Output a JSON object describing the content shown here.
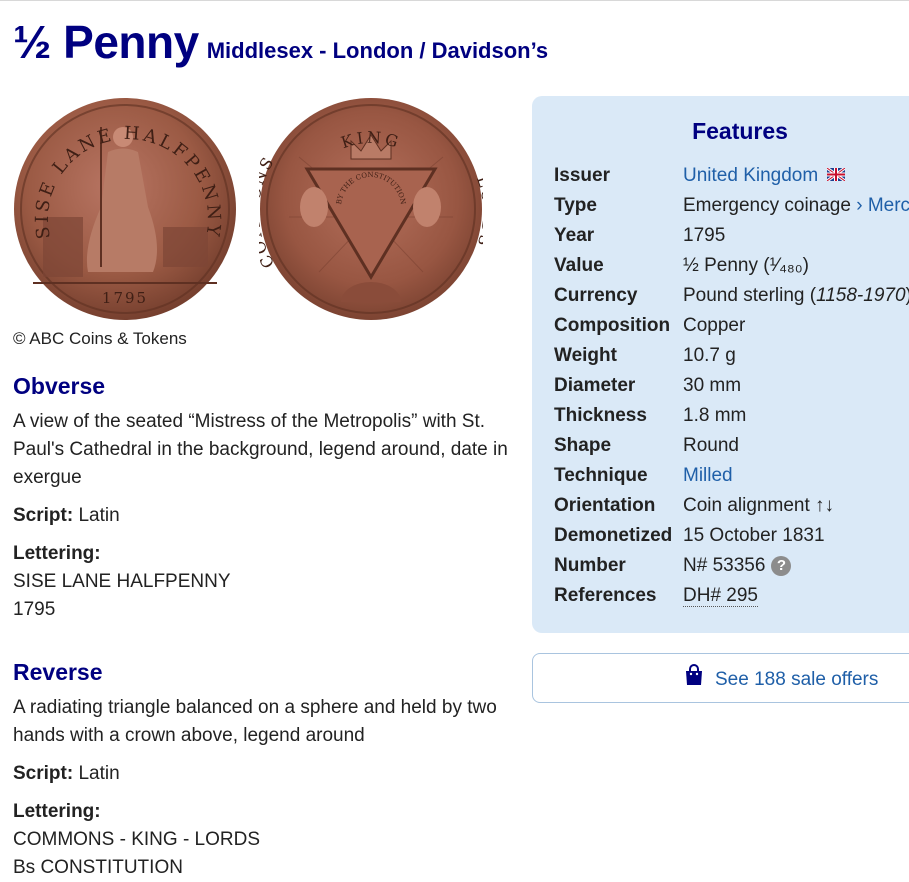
{
  "page": {
    "title": "½ Penny",
    "subtitle": "Middlesex - London / Davidson’s"
  },
  "images": {
    "obverse_legend": "SISE LANE HALFPENNY",
    "obverse_date": "1795",
    "reverse_top": "KING",
    "reverse_left": "COMMONS",
    "reverse_right": "LORDS",
    "reverse_center": "BY THE CONSTITUTION",
    "copyright": "© ABC Coins & Tokens"
  },
  "obverse": {
    "title": "Obverse",
    "description": "A view of the seated “Mistress of the Metropolis” with St. Paul's Cathedral in the background, legend around, date in exergue",
    "script_label": "Script:",
    "script_value": "Latin",
    "lettering_label": "Lettering:",
    "lettering_lines": [
      "SISE LANE HALFPENNY",
      "1795"
    ]
  },
  "reverse": {
    "title": "Reverse",
    "description": "A radiating triangle balanced on a sphere and held by two hands with a crown above, legend around",
    "script_label": "Script:",
    "script_value": "Latin",
    "lettering_label": "Lettering:",
    "lettering_lines": [
      "COMMONS - KING - LORDS",
      "Bs CONSTITUTION"
    ]
  },
  "features": {
    "title": "Features",
    "rows": [
      {
        "label": "Issuer",
        "value": "United Kingdom"
      },
      {
        "label": "Type",
        "value": "Emergency coinage",
        "sep": " › ",
        "link": "Merch"
      },
      {
        "label": "Year",
        "value": "1795"
      },
      {
        "label": "Value",
        "value": "½ Penny (¹⁄₄₈₀)"
      },
      {
        "label": "Currency",
        "value": "Pound sterling",
        "paren_open": " (",
        "italic": "1158-1970",
        "paren_close": ")"
      },
      {
        "label": "Composition",
        "value": "Copper"
      },
      {
        "label": "Weight",
        "value": "10.7 g"
      },
      {
        "label": "Diameter",
        "value": "30 mm"
      },
      {
        "label": "Thickness",
        "value": "1.8 mm"
      },
      {
        "label": "Shape",
        "value": "Round"
      },
      {
        "label": "Technique",
        "value": "Milled"
      },
      {
        "label": "Orientation",
        "value": "Coin alignment ↑↓"
      },
      {
        "label": "Demonetized",
        "value": "15 October 1831"
      },
      {
        "label": "Number",
        "value": "N# 53356",
        "help": "?"
      },
      {
        "label": "References",
        "value": "DH# 295"
      }
    ]
  },
  "offers": {
    "label": "See 188 sale offers"
  },
  "colors": {
    "heading": "#000080",
    "link": "#1f5fa8",
    "panel_bg": "#dae9f7",
    "coin_copper": "#9b5a44"
  },
  "icons": [
    "uk-flag-icon",
    "help-icon",
    "shopping-bag-icon"
  ]
}
